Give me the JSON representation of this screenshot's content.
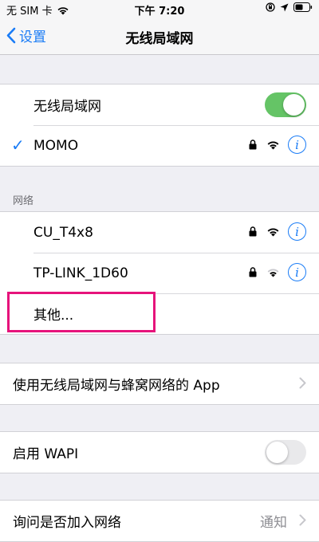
{
  "status_bar": {
    "carrier": "无 SIM 卡",
    "time": "下午 7:20"
  },
  "nav": {
    "back_label": "设置",
    "title": "无线局域网"
  },
  "wifi_toggle": {
    "label": "无线局域网",
    "state": "on"
  },
  "connected_network": {
    "name": "MOMO",
    "secured": true,
    "checked": true
  },
  "networks_section": {
    "header": "网络"
  },
  "networks": [
    {
      "name": "CU_T4x8",
      "secured": true,
      "signal": "full"
    },
    {
      "name": "TP-LINK_1D60",
      "secured": true,
      "signal": "medium"
    }
  ],
  "other_label": "其他...",
  "app_usage": {
    "label": "使用无线局域网与蜂窝网络的 App"
  },
  "wapi": {
    "label": "启用 WAPI",
    "state": "off"
  },
  "ask_join": {
    "label": "询问是否加入网络",
    "value": "通知"
  },
  "colors": {
    "accent": "#1a7cf6",
    "toggle_on": "#65c466",
    "highlight": "#e6137b"
  }
}
